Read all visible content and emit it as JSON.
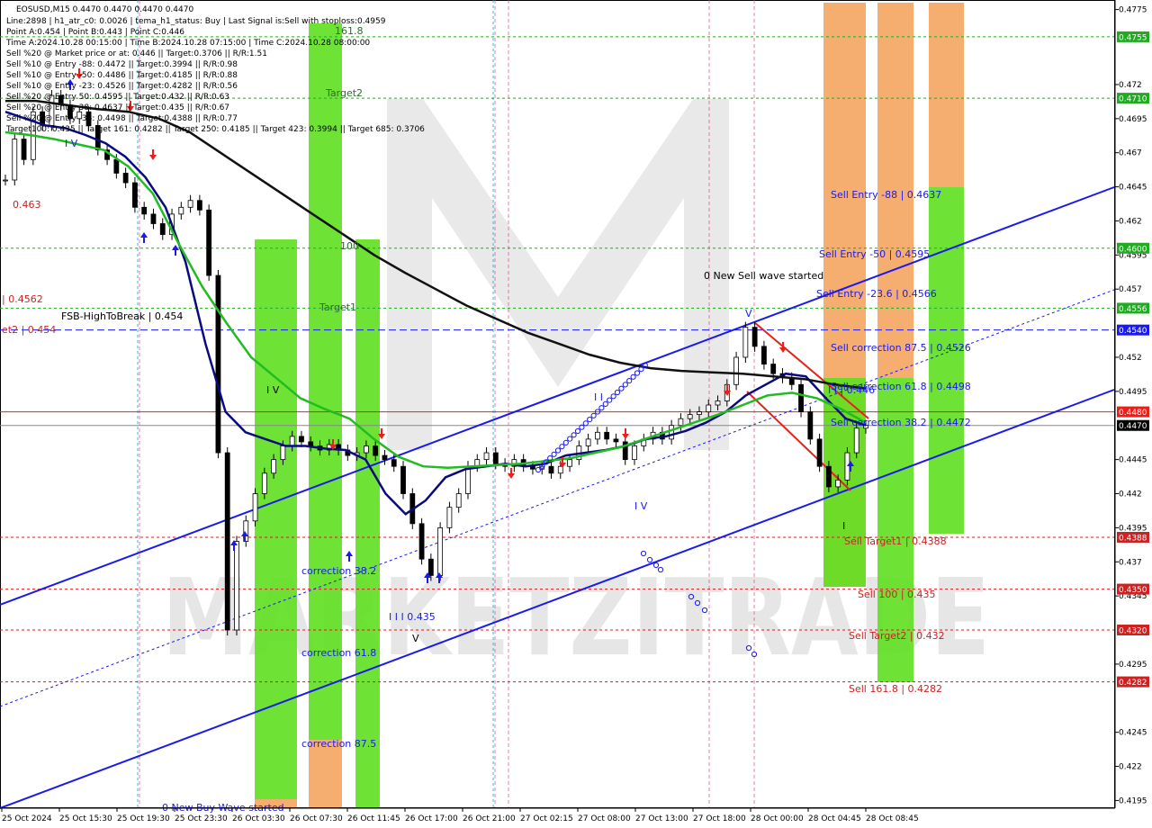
{
  "header": {
    "symbol_line": "EOSUSD,M15  0.4470 0.4470 0.4470 0.4470",
    "info_lines": [
      "Line:2898  | h1_atr_c0: 0.0026  | tema_h1_status: Buy  | Last Signal is:Sell with stoploss:0.4959",
      "Point A:0.454 | Point B:0.443 | Point C:0.446",
      "Time A:2024.10.28 00:15:00 | Time B:2024.10.28 07:15:00 | Time C:2024.10.28 08:00:00",
      "Sell %20 @ Market price or at: 0.446 || Target:0.3706 || R/R:1.51",
      "Sell %10 @ Entry -88: 0.4472 || Target:0.3994 || R/R:0.98",
      "Sell %10 @ Entry -50: 0.4486 || Target:0.4185 || R/R:0.88",
      "Sell %10 @ Entry -23: 0.4526 || Target:0.4282 || R/R:0.56",
      "Sell %20 @ Entry 50: 0.4595 || Target:0.432 || R/R:0.63",
      "Sell %20 @ Entry 38: 0.4637 || Target:0.435 || R/R:0.67",
      "Sell %20 @ Entry -38: 0.4498 || Target:0.4388 || R/R:0.77",
      "Target100: 0.435 || Target 161: 0.4282 || Target 250: 0.4185 || Target 423: 0.3994 || Target 685: 0.3706"
    ]
  },
  "chart_data": {
    "type": "line",
    "symbol": "EOSUSD",
    "timeframe": "M15",
    "x_tick_labels": [
      "25 Oct 2024",
      "25 Oct 15:30",
      "25 Oct 19:30",
      "25 Oct 23:30",
      "26 Oct 03:30",
      "26 Oct 07:30",
      "26 Oct 11:45",
      "26 Oct 17:00",
      "26 Oct 21:00",
      "27 Oct 02:15",
      "27 Oct 08:00",
      "27 Oct 13:00",
      "27 Oct 18:00",
      "28 Oct 00:00",
      "28 Oct 04:45",
      "28 Oct 08:45"
    ],
    "y_ticks": [
      0.4775,
      0.472,
      0.4695,
      0.467,
      0.4645,
      0.462,
      0.4595,
      0.457,
      0.452,
      0.4495,
      0.4445,
      0.442,
      0.4395,
      0.437,
      0.4345,
      0.4295,
      0.4245,
      0.422,
      0.4195
    ],
    "ylim": [
      0.419,
      0.4782
    ],
    "price_tags": [
      {
        "value": 0.4755,
        "label": "0.4755",
        "color": "#22aa22"
      },
      {
        "value": 0.471,
        "label": "0.4710",
        "color": "#22aa22"
      },
      {
        "value": 0.46,
        "label": "0.4600",
        "color": "#22aa22"
      },
      {
        "value": 0.4556,
        "label": "0.4556",
        "color": "#22aa22"
      },
      {
        "value": 0.454,
        "label": "0.4540",
        "color": "#1a1aee"
      },
      {
        "value": 0.448,
        "label": "0.4480",
        "color": "#e8201c"
      },
      {
        "value": 0.447,
        "label": "0.4470",
        "color": "#000000"
      },
      {
        "value": 0.4388,
        "label": "0.4388",
        "color": "#cc2222"
      },
      {
        "value": 0.435,
        "label": "0.4350",
        "color": "#cc2222"
      },
      {
        "value": 0.432,
        "label": "0.4320",
        "color": "#cc2222"
      },
      {
        "value": 0.4282,
        "label": "0.4282",
        "color": "#cc2222"
      }
    ],
    "annotations": [
      {
        "text": "0.463",
        "color": "#cc2222"
      },
      {
        "text": "| 0.4562",
        "color": "#cc2222"
      },
      {
        "text": "et2 | 0.454",
        "color": "#cc2222"
      },
      {
        "text": "FSB-HighToBreak | 0.454",
        "color": "#000000"
      },
      {
        "text": "161.8",
        "color": "#2a6e2a"
      },
      {
        "text": "Target2",
        "color": "#2a6e2a"
      },
      {
        "text": "100",
        "color": "#2a6e2a"
      },
      {
        "text": "Target1",
        "color": "#2a6e2a"
      },
      {
        "text": "I V",
        "color": "#000000"
      },
      {
        "text": "I V",
        "color": "#1a1aee"
      },
      {
        "text": "correction 38.2",
        "color": "#1a1aee"
      },
      {
        "text": "correction 61.8",
        "color": "#1a1aee"
      },
      {
        "text": "correction 87.5",
        "color": "#1a1aee"
      },
      {
        "text": "I I I 0.435",
        "color": "#1a1aee"
      },
      {
        "text": "V",
        "color": "#000000"
      },
      {
        "text": "0 New Buy Wave started",
        "color": "#1a1aee"
      },
      {
        "text": "I V",
        "color": "#1a1aee"
      },
      {
        "text": "I I",
        "color": "#1a1aee"
      },
      {
        "text": "0 New Sell wave started",
        "color": "#000000"
      },
      {
        "text": "V",
        "color": "#1a1aee"
      },
      {
        "text": "I I | 0.446",
        "color": "#1a1aee"
      },
      {
        "text": "I",
        "color": "#000000"
      },
      {
        "text": "Sell Entry -88 | 0.4637",
        "color": "#1a1aee"
      },
      {
        "text": "Sell Entry -50 | 0.4595",
        "color": "#1a1aee"
      },
      {
        "text": "Sell Entry -23.6 | 0.4566",
        "color": "#1a1aee"
      },
      {
        "text": "Sell correction 87.5 | 0.4526",
        "color": "#1a1aee"
      },
      {
        "text": "Sell correction 61.8 | 0.4498",
        "color": "#1a1aee"
      },
      {
        "text": "Sell correction 38.2 | 0.4472",
        "color": "#1a1aee"
      },
      {
        "text": "Sell Target1 | 0.4388",
        "color": "#cc2222"
      },
      {
        "text": "Sell 100 | 0.435",
        "color": "#cc2222"
      },
      {
        "text": "Sell Target2 | 0.432",
        "color": "#cc2222"
      },
      {
        "text": "Sell 161.8 | 0.4282",
        "color": "#cc2222"
      }
    ],
    "watermark": "MARKETZITRADE",
    "price_series": [
      0.465,
      0.468,
      0.4665,
      0.47,
      0.469,
      0.4712,
      0.4705,
      0.4695,
      0.47,
      0.469,
      0.4672,
      0.4665,
      0.4655,
      0.4648,
      0.463,
      0.4625,
      0.4618,
      0.461,
      0.4625,
      0.463,
      0.4635,
      0.4628,
      0.458,
      0.445,
      0.432,
      0.4385,
      0.44,
      0.442,
      0.4435,
      0.4445,
      0.4455,
      0.4462,
      0.4458,
      0.4455,
      0.4452,
      0.4456,
      0.4452,
      0.4448,
      0.445,
      0.4455,
      0.4448,
      0.4445,
      0.444,
      0.442,
      0.4398,
      0.4372,
      0.436,
      0.4395,
      0.441,
      0.442,
      0.444,
      0.4445,
      0.445,
      0.4442,
      0.444,
      0.4445,
      0.444,
      0.4438,
      0.444,
      0.4435,
      0.444,
      0.4445,
      0.4455,
      0.446,
      0.4465,
      0.446,
      0.4458,
      0.4445,
      0.4455,
      0.446,
      0.4465,
      0.446,
      0.447,
      0.4475,
      0.4478,
      0.448,
      0.4485,
      0.4488,
      0.45,
      0.452,
      0.4542,
      0.4528,
      0.4515,
      0.4508,
      0.4505,
      0.45,
      0.448,
      0.446,
      0.444,
      0.4425,
      0.443,
      0.445,
      0.4468,
      0.447
    ],
    "series": [
      {
        "name": "",
        "color": "#0a0a80",
        "values": [
          0.47,
          0.4695,
          0.469,
          0.4688,
          0.4683,
          0.4677,
          0.4667,
          0.4652,
          0.463,
          0.459,
          0.453,
          0.448,
          0.4465,
          0.446,
          0.4455,
          0.4455,
          0.4453,
          0.4452,
          0.4445,
          0.442,
          0.4405,
          0.4415,
          0.4432,
          0.4438,
          0.444,
          0.4442,
          0.444,
          0.4442,
          0.4448,
          0.445,
          0.4452,
          0.4455,
          0.446,
          0.4462,
          0.4466,
          0.4472,
          0.448,
          0.4492,
          0.45,
          0.4508,
          0.4506,
          0.449,
          0.4475,
          0.447
        ]
      },
      {
        "name": "",
        "color": "#22bb22",
        "values": [
          0.4685,
          0.4683,
          0.468,
          0.4676,
          0.4672,
          0.466,
          0.464,
          0.4605,
          0.4572,
          0.4545,
          0.452,
          0.4505,
          0.449,
          0.4482,
          0.4475,
          0.446,
          0.4447,
          0.444,
          0.4439,
          0.444,
          0.4441,
          0.4442,
          0.4444,
          0.4446,
          0.445,
          0.4454,
          0.446,
          0.4466,
          0.4472,
          0.4478,
          0.4485,
          0.4492,
          0.4494,
          0.449,
          0.4482,
          0.4472
        ]
      },
      {
        "name": "",
        "color": "#111111",
        "values": [
          0.4708,
          0.4708,
          0.4705,
          0.4702,
          0.47,
          0.4695,
          0.4685,
          0.467,
          0.4655,
          0.464,
          0.4625,
          0.461,
          0.4595,
          0.4582,
          0.457,
          0.4558,
          0.4548,
          0.4538,
          0.453,
          0.4522,
          0.4516,
          0.4512,
          0.451,
          0.4509,
          0.4508,
          0.4506,
          0.4504,
          0.45,
          0.4497
        ]
      }
    ],
    "grid": true
  }
}
